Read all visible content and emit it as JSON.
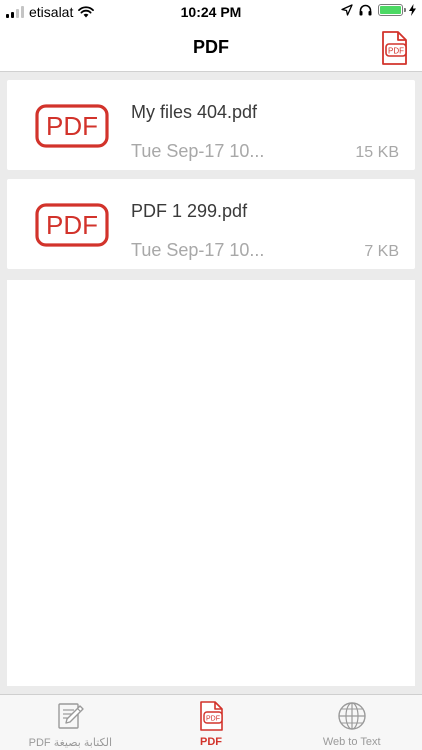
{
  "status_bar": {
    "carrier": "etisalat",
    "time": "10:24 PM"
  },
  "nav": {
    "title": "PDF",
    "action_icon": "pdf-file-icon"
  },
  "files": [
    {
      "thumbnail_text": "PDF",
      "name": "My files 404.pdf",
      "date": "Tue Sep-17 10...",
      "size": "15 KB"
    },
    {
      "thumbnail_text": "PDF",
      "name": "PDF 1 299.pdf",
      "date": "Tue Sep-17 10...",
      "size": "7 KB"
    }
  ],
  "tabs": [
    {
      "label": "PDF الكتابة بصيغة",
      "icon": "edit-document-icon",
      "active": false
    },
    {
      "label": "PDF",
      "icon": "pdf-file-icon",
      "active": true
    },
    {
      "label": "Web to Text",
      "icon": "globe-icon",
      "active": false
    }
  ],
  "colors": {
    "accent": "#d2332b",
    "inactive": "#9a9a9a",
    "background": "#ebebeb",
    "battery": "#4cd964"
  }
}
